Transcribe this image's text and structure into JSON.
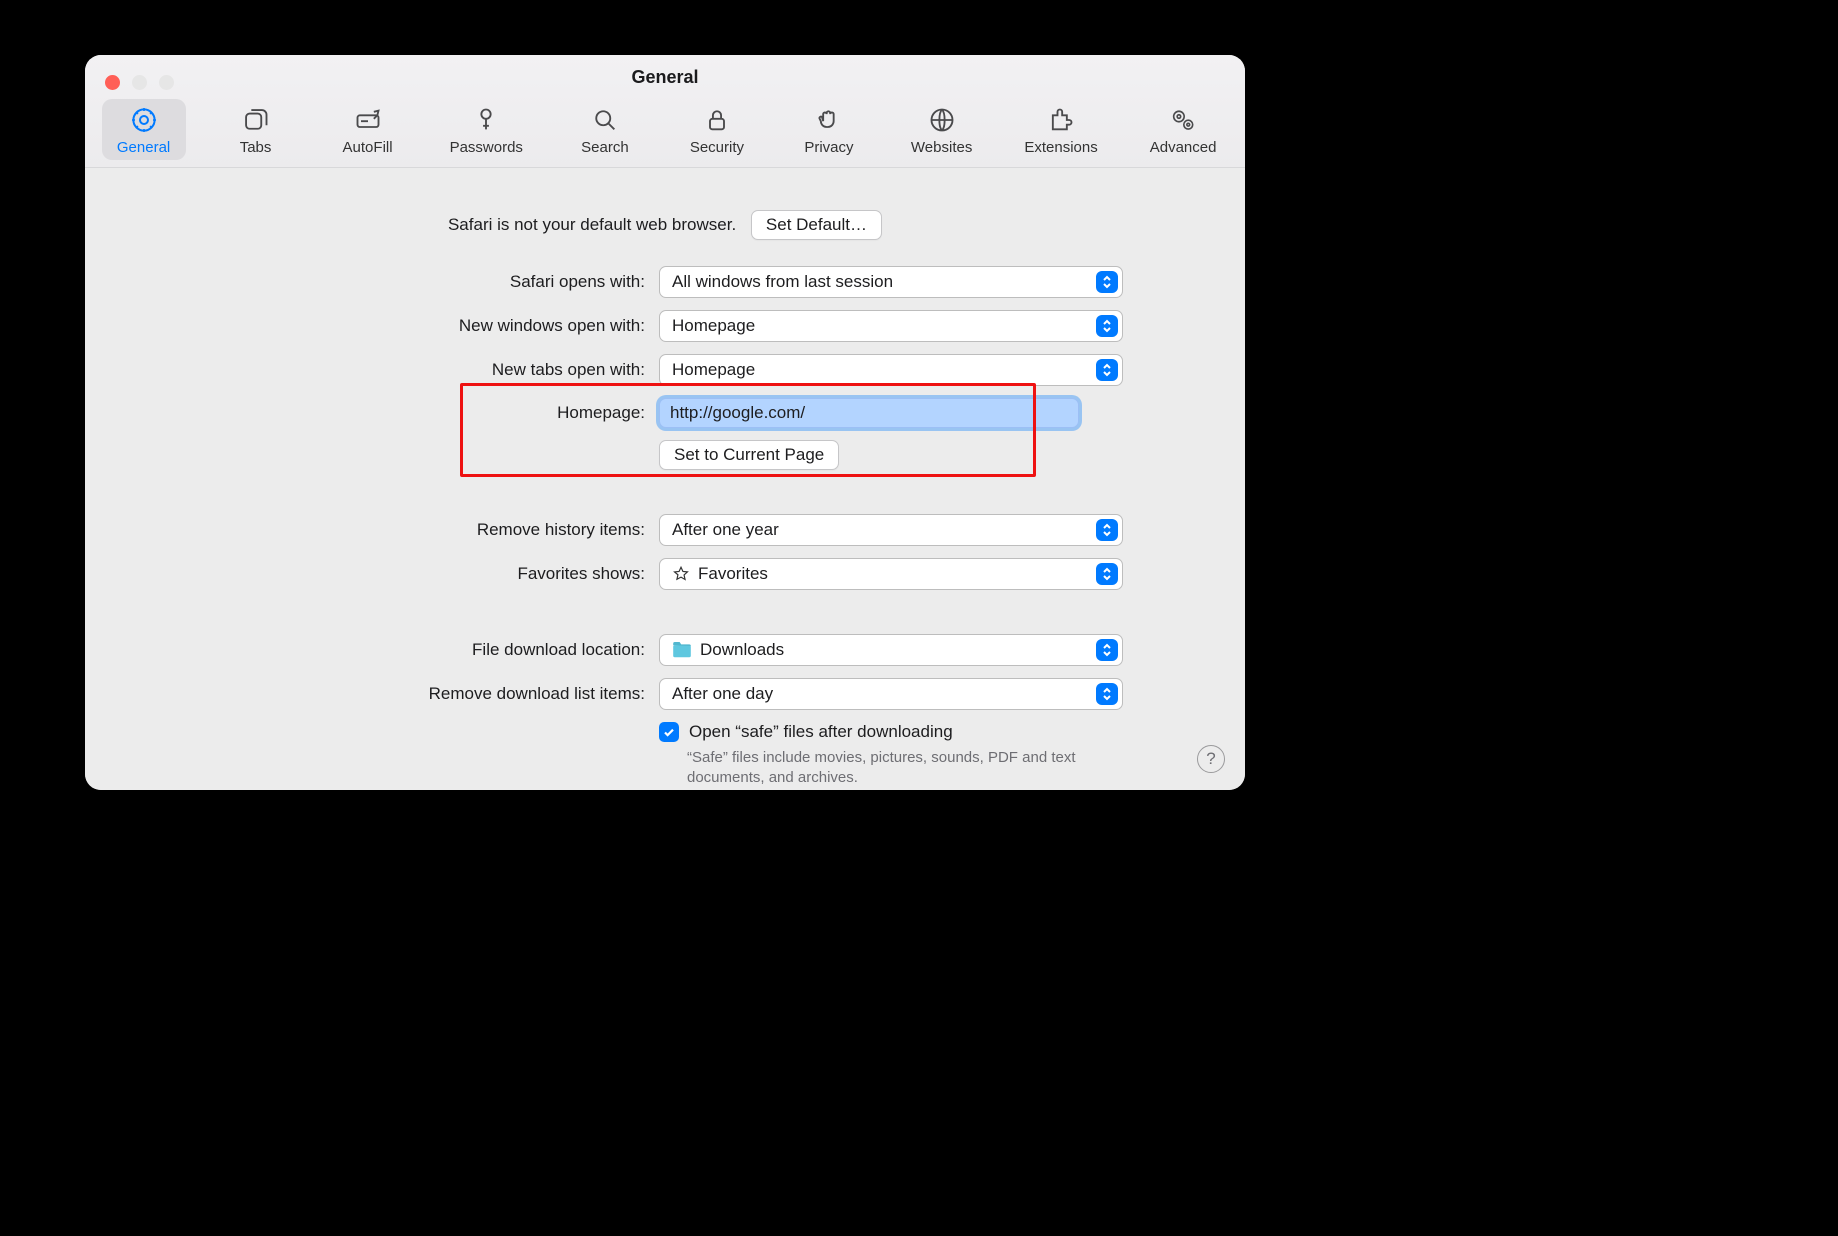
{
  "window": {
    "title": "General"
  },
  "toolbar": {
    "tabs": [
      {
        "id": "general",
        "label": "General"
      },
      {
        "id": "tabs",
        "label": "Tabs"
      },
      {
        "id": "autofill",
        "label": "AutoFill"
      },
      {
        "id": "passwords",
        "label": "Passwords"
      },
      {
        "id": "search",
        "label": "Search"
      },
      {
        "id": "security",
        "label": "Security"
      },
      {
        "id": "privacy",
        "label": "Privacy"
      },
      {
        "id": "websites",
        "label": "Websites"
      },
      {
        "id": "extensions",
        "label": "Extensions"
      },
      {
        "id": "advanced",
        "label": "Advanced"
      }
    ]
  },
  "default_browser": {
    "message": "Safari is not your default web browser.",
    "button": "Set Default…"
  },
  "safari_opens_with": {
    "label": "Safari opens with:",
    "value": "All windows from last session"
  },
  "new_windows_open": {
    "label": "New windows open with:",
    "value": "Homepage"
  },
  "new_tabs_open": {
    "label": "New tabs open with:",
    "value": "Homepage"
  },
  "homepage": {
    "label": "Homepage:",
    "value": "http://google.com/",
    "set_current": "Set to Current Page"
  },
  "remove_history": {
    "label": "Remove history items:",
    "value": "After one year"
  },
  "favorites_shows": {
    "label": "Favorites shows:",
    "value": "Favorites",
    "icon": "star"
  },
  "download_location": {
    "label": "File download location:",
    "value": "Downloads",
    "icon": "folder"
  },
  "remove_downloads": {
    "label": "Remove download list items:",
    "value": "After one day"
  },
  "safe_files": {
    "checked": true,
    "label": "Open “safe” files after downloading",
    "hint": "“Safe” files include movies, pictures, sounds, PDF and text documents, and archives."
  },
  "help_button": "?"
}
